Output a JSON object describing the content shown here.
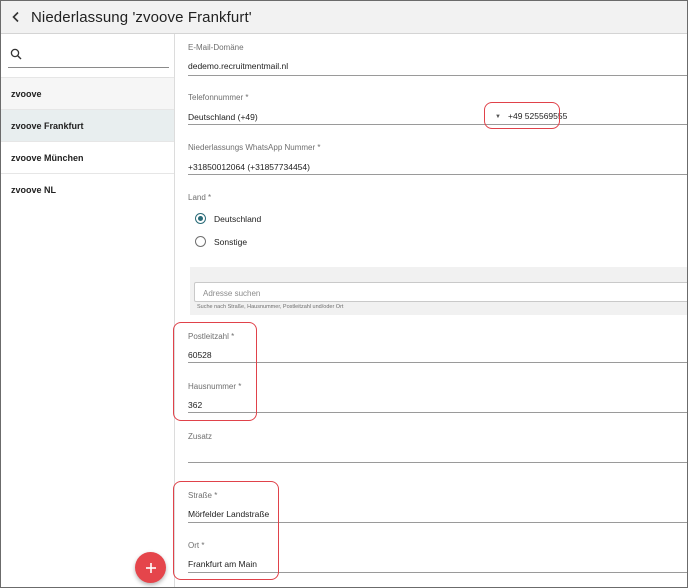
{
  "header": {
    "title": "Niederlassung 'zvoove Frankfurt'"
  },
  "search": {
    "placeholder": ""
  },
  "sidebar": {
    "items": [
      {
        "label": "zvoove"
      },
      {
        "label": "zvoove Frankfurt"
      },
      {
        "label": "zvoove München"
      },
      {
        "label": "zvoove NL"
      }
    ]
  },
  "form": {
    "email_domain": {
      "label": "E-Mail-Domäne",
      "value": "dedemo.recruitmentmail.nl"
    },
    "phone": {
      "label": "Telefonnummer *",
      "country": "Deutschland (+49)",
      "number": "+49 525569555"
    },
    "whatsapp": {
      "label": "Niederlassungs WhatsApp Nummer *",
      "value": "+31850012064 (+31857734454)"
    },
    "country": {
      "label": "Land *",
      "options": [
        {
          "label": "Deutschland",
          "selected": true
        },
        {
          "label": "Sonstige",
          "selected": false
        }
      ]
    },
    "address_search": {
      "placeholder": "Adresse suchen",
      "hint": "Suche nach Straße, Hausnummer, Postleitzahl und/oder Ort"
    },
    "postal_code": {
      "label": "Postleitzahl *",
      "value": "60528"
    },
    "house_number": {
      "label": "Hausnummer *",
      "value": "362"
    },
    "addition": {
      "label": "Zusatz",
      "value": ""
    },
    "street": {
      "label": "Straße *",
      "value": "Mörfelder Landstraße"
    },
    "city": {
      "label": "Ort *",
      "value": "Frankfurt am Main"
    }
  },
  "colors": {
    "accent": "#2b6b78",
    "fab": "#e5454b",
    "highlight": "#e0424a"
  },
  "icons": {
    "back": "chevron-left-icon",
    "search": "search-icon",
    "fab": "plus-icon"
  }
}
